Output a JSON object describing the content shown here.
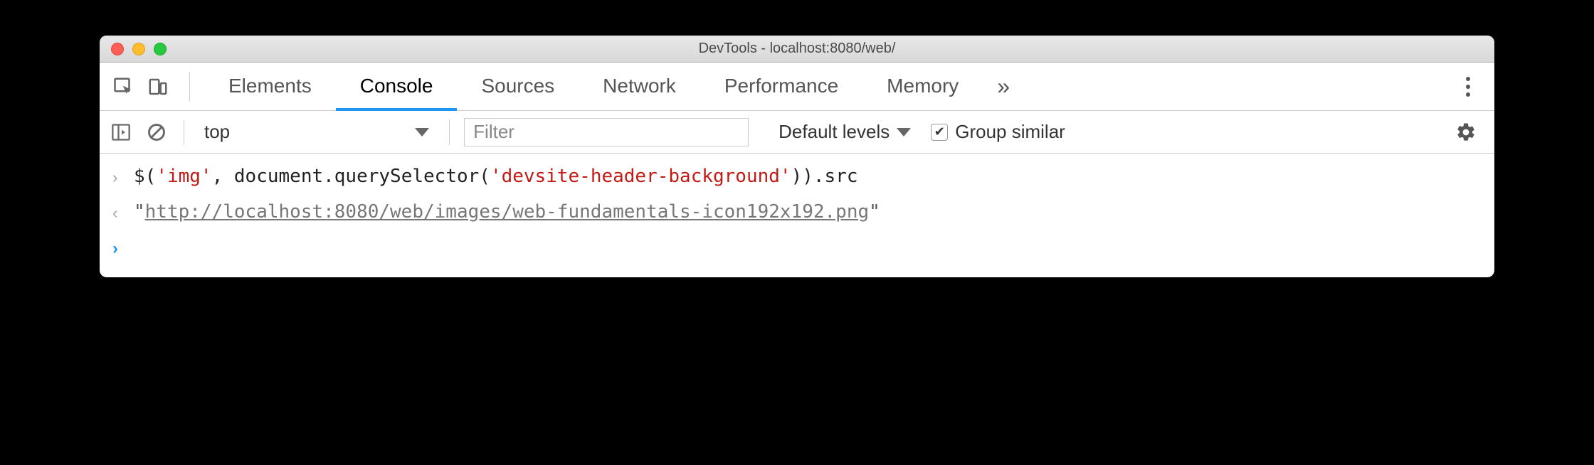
{
  "window": {
    "title": "DevTools - localhost:8080/web/"
  },
  "tabs": {
    "items": [
      "Elements",
      "Console",
      "Sources",
      "Network",
      "Performance",
      "Memory"
    ],
    "active_index": 1,
    "more_glyph": "»"
  },
  "filter_bar": {
    "context": "top",
    "filter_placeholder": "Filter",
    "levels_label": "Default levels",
    "group_similar_label": "Group similar",
    "group_similar_checked": true
  },
  "console": {
    "input_prefix": "$(",
    "input_str1": "'img'",
    "input_mid": ", document.querySelector(",
    "input_str2": "'devsite-header-background'",
    "input_suffix": ")).src",
    "output_quote_open": "\"",
    "output_url": "http://localhost:8080/web/images/web-fundamentals-icon192x192.png",
    "output_quote_close": "\"",
    "prompt_glyph": "›",
    "return_glyph": "‹"
  }
}
